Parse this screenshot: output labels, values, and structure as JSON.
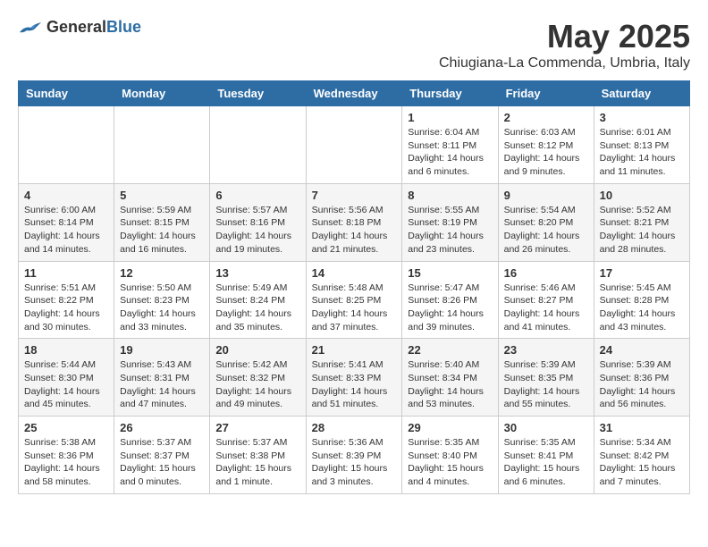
{
  "header": {
    "logo_general": "General",
    "logo_blue": "Blue",
    "month_title": "May 2025",
    "location": "Chiugiana-La Commenda, Umbria, Italy"
  },
  "days_of_week": [
    "Sunday",
    "Monday",
    "Tuesday",
    "Wednesday",
    "Thursday",
    "Friday",
    "Saturday"
  ],
  "weeks": [
    [
      {
        "day": "",
        "info": ""
      },
      {
        "day": "",
        "info": ""
      },
      {
        "day": "",
        "info": ""
      },
      {
        "day": "",
        "info": ""
      },
      {
        "day": "1",
        "info": "Sunrise: 6:04 AM\nSunset: 8:11 PM\nDaylight: 14 hours\nand 6 minutes."
      },
      {
        "day": "2",
        "info": "Sunrise: 6:03 AM\nSunset: 8:12 PM\nDaylight: 14 hours\nand 9 minutes."
      },
      {
        "day": "3",
        "info": "Sunrise: 6:01 AM\nSunset: 8:13 PM\nDaylight: 14 hours\nand 11 minutes."
      }
    ],
    [
      {
        "day": "4",
        "info": "Sunrise: 6:00 AM\nSunset: 8:14 PM\nDaylight: 14 hours\nand 14 minutes."
      },
      {
        "day": "5",
        "info": "Sunrise: 5:59 AM\nSunset: 8:15 PM\nDaylight: 14 hours\nand 16 minutes."
      },
      {
        "day": "6",
        "info": "Sunrise: 5:57 AM\nSunset: 8:16 PM\nDaylight: 14 hours\nand 19 minutes."
      },
      {
        "day": "7",
        "info": "Sunrise: 5:56 AM\nSunset: 8:18 PM\nDaylight: 14 hours\nand 21 minutes."
      },
      {
        "day": "8",
        "info": "Sunrise: 5:55 AM\nSunset: 8:19 PM\nDaylight: 14 hours\nand 23 minutes."
      },
      {
        "day": "9",
        "info": "Sunrise: 5:54 AM\nSunset: 8:20 PM\nDaylight: 14 hours\nand 26 minutes."
      },
      {
        "day": "10",
        "info": "Sunrise: 5:52 AM\nSunset: 8:21 PM\nDaylight: 14 hours\nand 28 minutes."
      }
    ],
    [
      {
        "day": "11",
        "info": "Sunrise: 5:51 AM\nSunset: 8:22 PM\nDaylight: 14 hours\nand 30 minutes."
      },
      {
        "day": "12",
        "info": "Sunrise: 5:50 AM\nSunset: 8:23 PM\nDaylight: 14 hours\nand 33 minutes."
      },
      {
        "day": "13",
        "info": "Sunrise: 5:49 AM\nSunset: 8:24 PM\nDaylight: 14 hours\nand 35 minutes."
      },
      {
        "day": "14",
        "info": "Sunrise: 5:48 AM\nSunset: 8:25 PM\nDaylight: 14 hours\nand 37 minutes."
      },
      {
        "day": "15",
        "info": "Sunrise: 5:47 AM\nSunset: 8:26 PM\nDaylight: 14 hours\nand 39 minutes."
      },
      {
        "day": "16",
        "info": "Sunrise: 5:46 AM\nSunset: 8:27 PM\nDaylight: 14 hours\nand 41 minutes."
      },
      {
        "day": "17",
        "info": "Sunrise: 5:45 AM\nSunset: 8:28 PM\nDaylight: 14 hours\nand 43 minutes."
      }
    ],
    [
      {
        "day": "18",
        "info": "Sunrise: 5:44 AM\nSunset: 8:30 PM\nDaylight: 14 hours\nand 45 minutes."
      },
      {
        "day": "19",
        "info": "Sunrise: 5:43 AM\nSunset: 8:31 PM\nDaylight: 14 hours\nand 47 minutes."
      },
      {
        "day": "20",
        "info": "Sunrise: 5:42 AM\nSunset: 8:32 PM\nDaylight: 14 hours\nand 49 minutes."
      },
      {
        "day": "21",
        "info": "Sunrise: 5:41 AM\nSunset: 8:33 PM\nDaylight: 14 hours\nand 51 minutes."
      },
      {
        "day": "22",
        "info": "Sunrise: 5:40 AM\nSunset: 8:34 PM\nDaylight: 14 hours\nand 53 minutes."
      },
      {
        "day": "23",
        "info": "Sunrise: 5:39 AM\nSunset: 8:35 PM\nDaylight: 14 hours\nand 55 minutes."
      },
      {
        "day": "24",
        "info": "Sunrise: 5:39 AM\nSunset: 8:36 PM\nDaylight: 14 hours\nand 56 minutes."
      }
    ],
    [
      {
        "day": "25",
        "info": "Sunrise: 5:38 AM\nSunset: 8:36 PM\nDaylight: 14 hours\nand 58 minutes."
      },
      {
        "day": "26",
        "info": "Sunrise: 5:37 AM\nSunset: 8:37 PM\nDaylight: 15 hours\nand 0 minutes."
      },
      {
        "day": "27",
        "info": "Sunrise: 5:37 AM\nSunset: 8:38 PM\nDaylight: 15 hours\nand 1 minute."
      },
      {
        "day": "28",
        "info": "Sunrise: 5:36 AM\nSunset: 8:39 PM\nDaylight: 15 hours\nand 3 minutes."
      },
      {
        "day": "29",
        "info": "Sunrise: 5:35 AM\nSunset: 8:40 PM\nDaylight: 15 hours\nand 4 minutes."
      },
      {
        "day": "30",
        "info": "Sunrise: 5:35 AM\nSunset: 8:41 PM\nDaylight: 15 hours\nand 6 minutes."
      },
      {
        "day": "31",
        "info": "Sunrise: 5:34 AM\nSunset: 8:42 PM\nDaylight: 15 hours\nand 7 minutes."
      }
    ]
  ]
}
